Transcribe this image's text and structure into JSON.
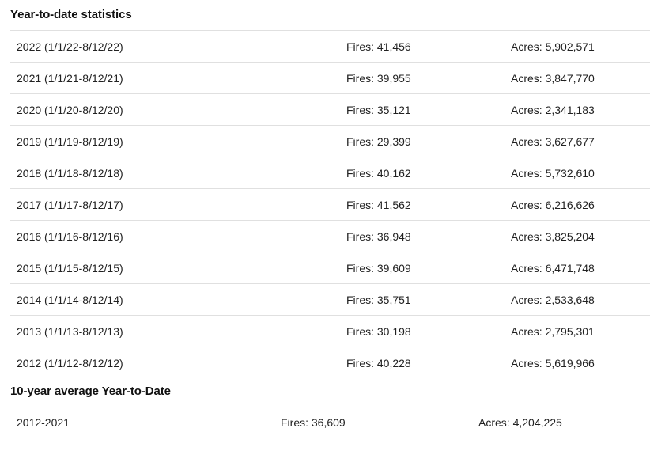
{
  "ytd": {
    "title": "Year-to-date statistics",
    "rows": [
      {
        "period": "2022 (1/1/22-8/12/22)",
        "fires": "Fires: 41,456",
        "acres": "Acres: 5,902,571"
      },
      {
        "period": "2021 (1/1/21-8/12/21)",
        "fires": "Fires: 39,955",
        "acres": "Acres: 3,847,770"
      },
      {
        "period": "2020 (1/1/20-8/12/20)",
        "fires": "Fires: 35,121",
        "acres": "Acres: 2,341,183"
      },
      {
        "period": "2019 (1/1/19-8/12/19)",
        "fires": "Fires: 29,399",
        "acres": "Acres: 3,627,677"
      },
      {
        "period": "2018 (1/1/18-8/12/18)",
        "fires": "Fires: 40,162",
        "acres": "Acres: 5,732,610"
      },
      {
        "period": "2017 (1/1/17-8/12/17)",
        "fires": "Fires: 41,562",
        "acres": "Acres: 6,216,626"
      },
      {
        "period": "2016 (1/1/16-8/12/16)",
        "fires": "Fires: 36,948",
        "acres": "Acres: 3,825,204"
      },
      {
        "period": "2015 (1/1/15-8/12/15)",
        "fires": "Fires: 39,609",
        "acres": "Acres: 6,471,748"
      },
      {
        "period": "2014 (1/1/14-8/12/14)",
        "fires": "Fires: 35,751",
        "acres": "Acres: 2,533,648"
      },
      {
        "period": "2013 (1/1/13-8/12/13)",
        "fires": "Fires: 30,198",
        "acres": "Acres: 2,795,301"
      },
      {
        "period": "2012 (1/1/12-8/12/12)",
        "fires": "Fires: 40,228",
        "acres": "Acres: 5,619,966"
      }
    ]
  },
  "average": {
    "title": "10-year average Year-to-Date",
    "rows": [
      {
        "period": "2012-2021",
        "fires": "Fires: 36,609",
        "acres": "Acres: 4,204,225"
      }
    ]
  }
}
